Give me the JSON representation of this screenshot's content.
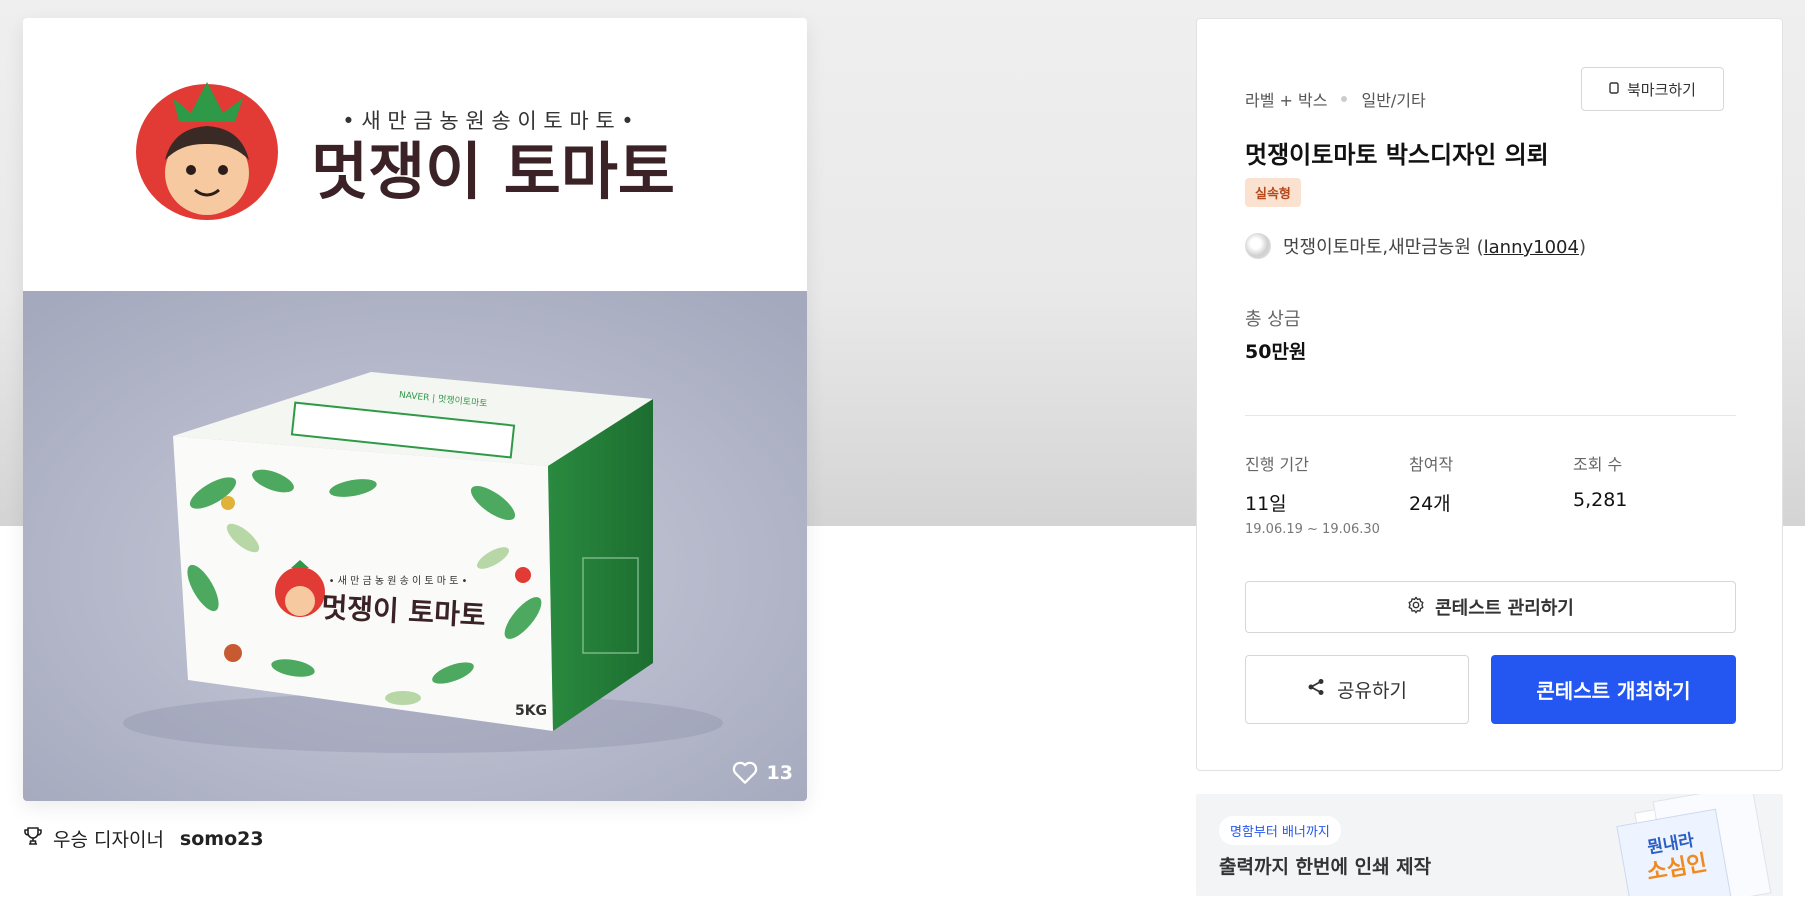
{
  "product": {
    "logo_tagline": "• 새 만 금 농 원 송 이 토 마 토 •",
    "logo_title": "멋쟁이 토마토",
    "box_tagline": "• 새 만 금 농 원 송 이 토 마 토 •",
    "box_title": "멋쟁이 토마토",
    "box_weight": "5KG",
    "box_brand": "NAVER | 멋쟁이토마토",
    "likes": "13"
  },
  "winner": {
    "label": "우승 디자이너",
    "name": "somo23"
  },
  "contest": {
    "category1": "라벨 + 박스",
    "category2": "일반/기타",
    "bookmark_label": "북마크하기",
    "title": "멋쟁이토마토 박스디자인 의뢰",
    "badge": "실속형",
    "host_name": "멋쟁이토마토,새만금농원 (",
    "host_id": "lanny1004",
    "host_close": ")",
    "prize_label": "총 상금",
    "prize_value": "50만원",
    "stats": [
      {
        "label": "진행 기간",
        "value": "11일",
        "sub": "19.06.19 ~ 19.06.30"
      },
      {
        "label": "참여작",
        "value": "24개",
        "sub": ""
      },
      {
        "label": "조회 수",
        "value": "5,281",
        "sub": ""
      }
    ],
    "manage_label": "콘테스트 관리하기",
    "share_label": "공유하기",
    "host_contest_label": "콘테스트 개최하기"
  },
  "banner": {
    "tag": "명함부터 배너까지",
    "text": "출력까지 한번에 인쇄 제작",
    "art_text1": "뭔내라",
    "art_text2": "소심인"
  },
  "colors": {
    "primary": "#2456f2",
    "badge_bg": "#fbe1d0",
    "badge_text": "#b4491c",
    "tomato_red": "#e23a34",
    "leaf_green": "#2e9a47"
  }
}
